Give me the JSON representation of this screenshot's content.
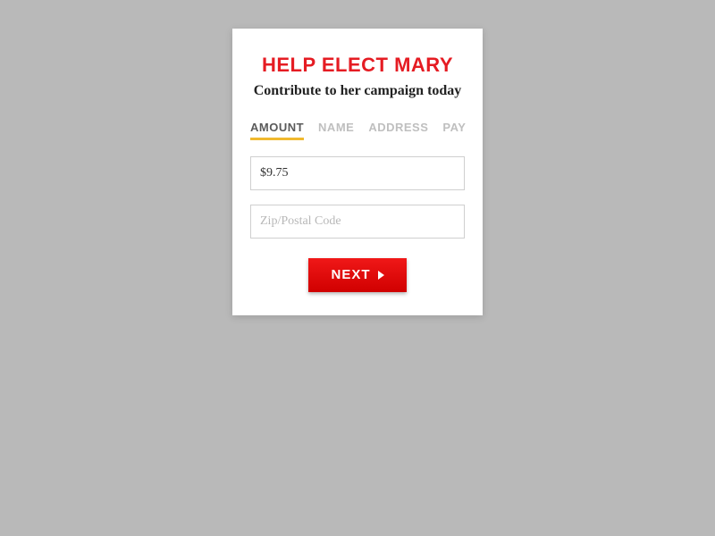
{
  "header": {
    "title": "HELP ELECT MARY",
    "subtitle": "Contribute to her campaign today"
  },
  "tabs": {
    "items": [
      {
        "label": "AMOUNT",
        "active": true
      },
      {
        "label": "NAME",
        "active": false
      },
      {
        "label": "ADDRESS",
        "active": false
      },
      {
        "label": "PAY",
        "active": false
      }
    ]
  },
  "form": {
    "amount_value": "$9.75",
    "zip_placeholder": "Zip/Postal Code"
  },
  "button": {
    "next_label": "NEXT"
  },
  "colors": {
    "accent_red": "#e51c23",
    "underline_gold": "#f0b92f"
  }
}
